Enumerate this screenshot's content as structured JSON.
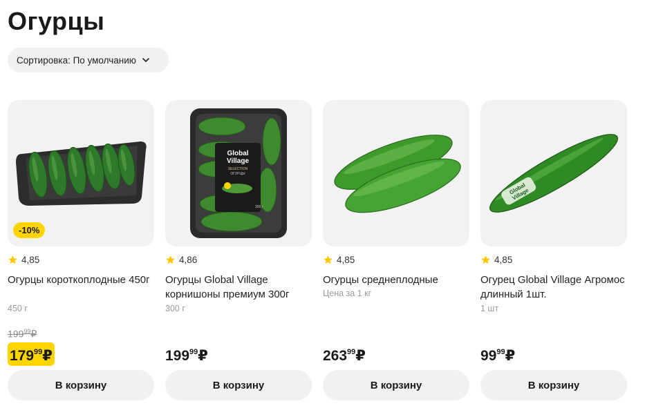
{
  "page": {
    "title": "Огурцы"
  },
  "sort": {
    "label": "Сортировка: По умолчанию"
  },
  "products": [
    {
      "badge": "-10%",
      "rating": "4,85",
      "name": "Огурцы короткоплодные 450г",
      "unit": "450 г",
      "old_price_main": "199",
      "old_price_kop": "99",
      "old_price_cur": "₽",
      "price_main": "179",
      "price_kop": "99",
      "price_cur": "₽",
      "cart_label": "В корзину"
    },
    {
      "rating": "4,86",
      "name": "Огурцы Global Village корнишоны премиум 300г",
      "unit": "300 г",
      "price_main": "199",
      "price_kop": "99",
      "price_cur": "₽",
      "cart_label": "В корзину",
      "pack_brand_1": "Global",
      "pack_brand_2": "Village",
      "pack_line": "SELECTION",
      "pack_product": "ОГУРЦЫ",
      "pack_weight": "300 г"
    },
    {
      "rating": "4,85",
      "name": "Огурцы среднеплодные",
      "unit": "Цена за 1 кг",
      "price_main": "263",
      "price_kop": "99",
      "price_cur": "₽",
      "cart_label": "В корзину"
    },
    {
      "rating": "4,85",
      "name": "Огурец Global Village Агромос длинный 1шт.",
      "unit": "1 шт",
      "price_main": "99",
      "price_kop": "99",
      "price_cur": "₽",
      "cart_label": "В корзину",
      "label_1": "Global",
      "label_2": "Village"
    }
  ],
  "colors": {
    "accent_yellow": "#ffd400",
    "button_bg": "#f1f1f1",
    "card_bg": "#f2f2f2"
  },
  "icons": {
    "sort_chevron": "chevron-down-icon",
    "rating": "star-icon"
  }
}
